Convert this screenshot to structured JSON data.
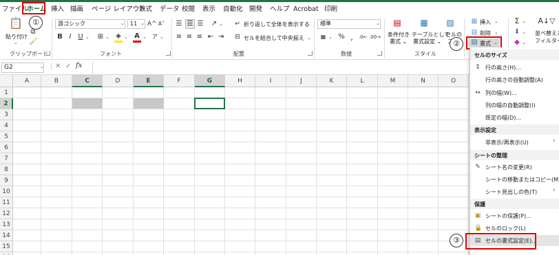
{
  "tabs": [
    "ファイル",
    "ホーム",
    "挿入",
    "描画",
    "ページ レイアウト",
    "数式",
    "データ",
    "校閲",
    "表示",
    "自動化",
    "開発",
    "ヘルプ",
    "Acrobat",
    "印刷"
  ],
  "annotations": [
    "①",
    "②",
    "③"
  ],
  "ribbon": {
    "paste_label": "貼り付け",
    "font_name": "游ゴシック",
    "font_size": "11",
    "bold": "B",
    "italic": "I",
    "underline": "U",
    "font_grow": "A^",
    "font_shrink": "A˅",
    "wrap_text": "折り返して全体を表示する",
    "merge_center": "セルを結合して中央揃え",
    "number_format": "標準",
    "conditional_format": "条件付き\n書式",
    "conditional_format_l1": "条件付き",
    "conditional_format_l2": "書式 ⌄",
    "table_format_l1": "テーブルとして",
    "table_format_l2": "書式設定 ⌄",
    "cell_styles_l1": "セルの",
    "cell_styles_l2": "スタ",
    "insert": "挿入",
    "delete": "削除",
    "format": "書式",
    "sort_filter_l1": "並べ替えと",
    "sort_filter_l2": "フィルター",
    "sum_symbol": "Σ",
    "groups": {
      "clipboard": "クリップボード",
      "font": "フォント",
      "alignment": "配置",
      "number": "数値",
      "style": "スタイル"
    }
  },
  "formula_bar": {
    "name_box": "G2",
    "fx": "fx",
    "cancel": "✕",
    "enter": "✓"
  },
  "columns": [
    "A",
    "B",
    "C",
    "D",
    "E",
    "F",
    "G",
    "H",
    "I",
    "J",
    "K",
    "L",
    "M",
    "N",
    "O"
  ],
  "rows": [
    "1",
    "2",
    "3",
    "4",
    "5",
    "6",
    "7",
    "8",
    "9",
    "10",
    "11",
    "12",
    "13",
    "14",
    "15",
    "16"
  ],
  "menu": {
    "size_header": "セルのサイズ",
    "row_height": "行の高さ(H)...",
    "row_autofit": "行の高さの自動調整(A)",
    "col_width": "列の幅(W)...",
    "col_autofit": "列の幅の自動調整(I)",
    "default_width": "既定の幅(D)...",
    "visibility_header": "表示設定",
    "hide_unhide": "非表示/再表示(U)",
    "organize_header": "シートの整理",
    "rename_sheet": "シート名の変更(R)",
    "move_copy": "シートの移動またはコピー(M)...",
    "tab_color": "シート見出しの色(T)",
    "protection_header": "保護",
    "protect_sheet": "シートの保護(P)...",
    "lock_cell": "セルのロック(L)",
    "format_cells": "セルの書式設定(E)..."
  },
  "colors": {
    "accent": "#217346",
    "annotation": "#e00000",
    "selected_fill": "#c8c8c8"
  }
}
